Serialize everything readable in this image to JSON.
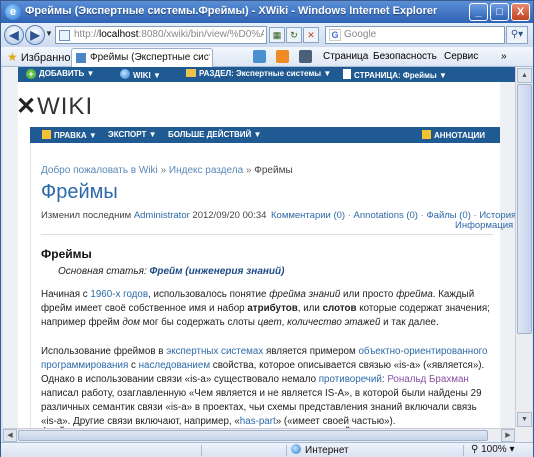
{
  "window": {
    "title": "Фреймы (Экспертные системы.Фреймы) - XWiki - Windows Internet Explorer",
    "minimize": "_",
    "maximize": "□",
    "close": "X"
  },
  "address": {
    "url_prefix": "http://",
    "url_host": "localhost",
    "url_rest": ":8080/xwiki/bin/view/%D0%AD%D0",
    "search_placeholder": "Google"
  },
  "favorites": {
    "label": "Избранное",
    "tab_label": "Фреймы (Экспертные системы...",
    "commands": [
      "Страница",
      "Безопасность",
      "Сервис"
    ]
  },
  "xwiki_topbar": {
    "add": "ДОБАВИТЬ",
    "wiki": "WIKI",
    "space": "РАЗДЕЛ: Экспертные системы",
    "page": "СТРАНИЦА: Фреймы"
  },
  "logo": "WIKI",
  "menubar": {
    "edit": "ПРАВКА",
    "export": "ЭКСПОРТ",
    "more": "БОЛЬШЕ ДЕЙСТВИЙ",
    "annotations": "АННОТАЦИИ"
  },
  "breadcrumb": {
    "home": "Добро пожаловать в Wiki",
    "sep": "»",
    "space": "Индекс раздела",
    "current": "Фреймы"
  },
  "page": {
    "title": "Фреймы",
    "modified_by_label": "Изменил последним",
    "author": "Administrator",
    "date": "2012/09/20 00:34",
    "comments": "Комментарии (0)",
    "annotations": "Annotations (0)",
    "files": "Файлы (0)",
    "history": "История",
    "info": "Информация",
    "heading": "Фреймы",
    "main_article_label": "Основная статья:",
    "main_article_link": "Фрейм (инженерия знаний)"
  },
  "paragraphs": {
    "p1": "Начиная с <a>1960-х годов</a>, использовалось понятие <i>фрейма знаний</i> или просто <i>фрейма</i>. Каждый фрейм имеет своё собственное имя и набор <b>атрибутов</b>, или <b>слотов</b> которые содержат значения; например фрейм <i>дом</i> мог бы содержать слоты <i>цвет</i>, <i>количество этажей</i> и так далее.",
    "p2": "Использование фреймов в <a>экспертных системах</a> является примером <a>объектно-ориентированного программирования</a> с <a>наследованием</a> свойства, которое описывается связью «is-a» («является»). Однако в использовании связи «is-a» существовало немало <a>противоречий</a>: <a class=\"v\">Рональд Брахман</a> написал работу, озаглавленную «Чем является и не является IS-A», в которой были найдены 29 различных семантик связи «is-a» в проектах, чьи схемы представления знаний включали связь «is-a». Другие связи включают, например, «<a>has-part</a>» («имеет своей частью»).",
    "p3": "Фреймовые структуры хорошо подходят для представления знаний, представленных в виде схем и"
  },
  "status": {
    "zone": "Интернет",
    "zoom": "100%"
  }
}
